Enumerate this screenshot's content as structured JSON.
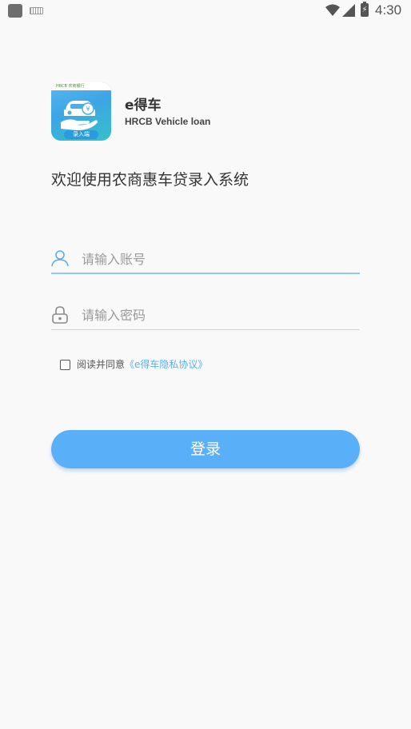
{
  "status_bar": {
    "time": "4:30",
    "battery_glyph": "⚡",
    "icons": [
      "app-notification-icon",
      "keyboard-icon",
      "wifi-icon",
      "signal-icon",
      "battery-charging-icon"
    ]
  },
  "brand": {
    "logo_top_text": "HRCB 农商银行",
    "logo_label": "录入端",
    "app_name": "e得车",
    "app_subtitle": "HRCB Vehicle loan"
  },
  "welcome_text": "欢迎使用农商惠车贷录入系统",
  "form": {
    "account_placeholder": "请输入账号",
    "account_value": "",
    "password_placeholder": "请输入密码",
    "password_value": ""
  },
  "agreement": {
    "checked": false,
    "prefix": "阅读并同意",
    "link": "《e得车隐私协议》"
  },
  "login_label": "登录",
  "colors": {
    "accent": "#5ab0f8",
    "link": "#5aaef0",
    "background": "#f9f9fa"
  }
}
